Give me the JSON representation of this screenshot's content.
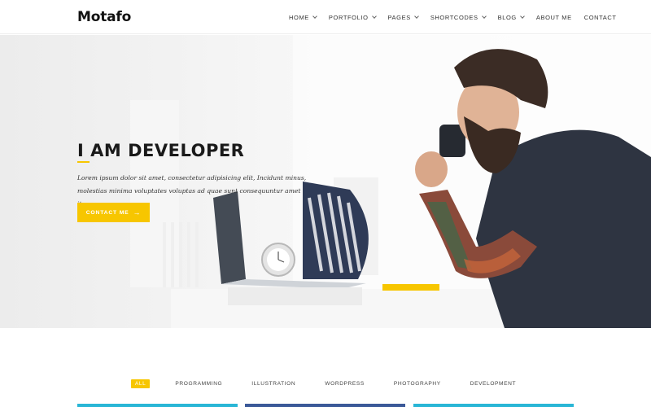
{
  "brand": {
    "logo": "Motafo",
    "accent": "#f7c600"
  },
  "nav": {
    "items": [
      {
        "label": "HOME",
        "dropdown": true
      },
      {
        "label": "PORTFOLIO",
        "dropdown": true
      },
      {
        "label": "PAGES",
        "dropdown": true
      },
      {
        "label": "SHORTCODES",
        "dropdown": true
      },
      {
        "label": "BLOG",
        "dropdown": true
      },
      {
        "label": "ABOUT ME",
        "dropdown": false
      },
      {
        "label": "CONTACT",
        "dropdown": false
      }
    ]
  },
  "hero": {
    "title": "I AM DEVELOPER",
    "text": "Lorem ipsum dolor sit amet, consectetur adipisicing elit, Incidunt minus, molestias minima voluptates voluptas ad quae sunt consequuntur amet itaque",
    "cta_label": "CONTACT ME",
    "cta_icon": "arrow-right-icon"
  },
  "filters": {
    "items": [
      "ALL",
      "PROGRAMMING",
      "ILLUSTRATION",
      "WORDPRESS",
      "PHOTOGRAPHY",
      "DEVELOPMENT"
    ],
    "active": "ALL"
  },
  "cards": {
    "colors": [
      "#29b6d6",
      "#3b5998",
      "#29b6d6"
    ]
  }
}
